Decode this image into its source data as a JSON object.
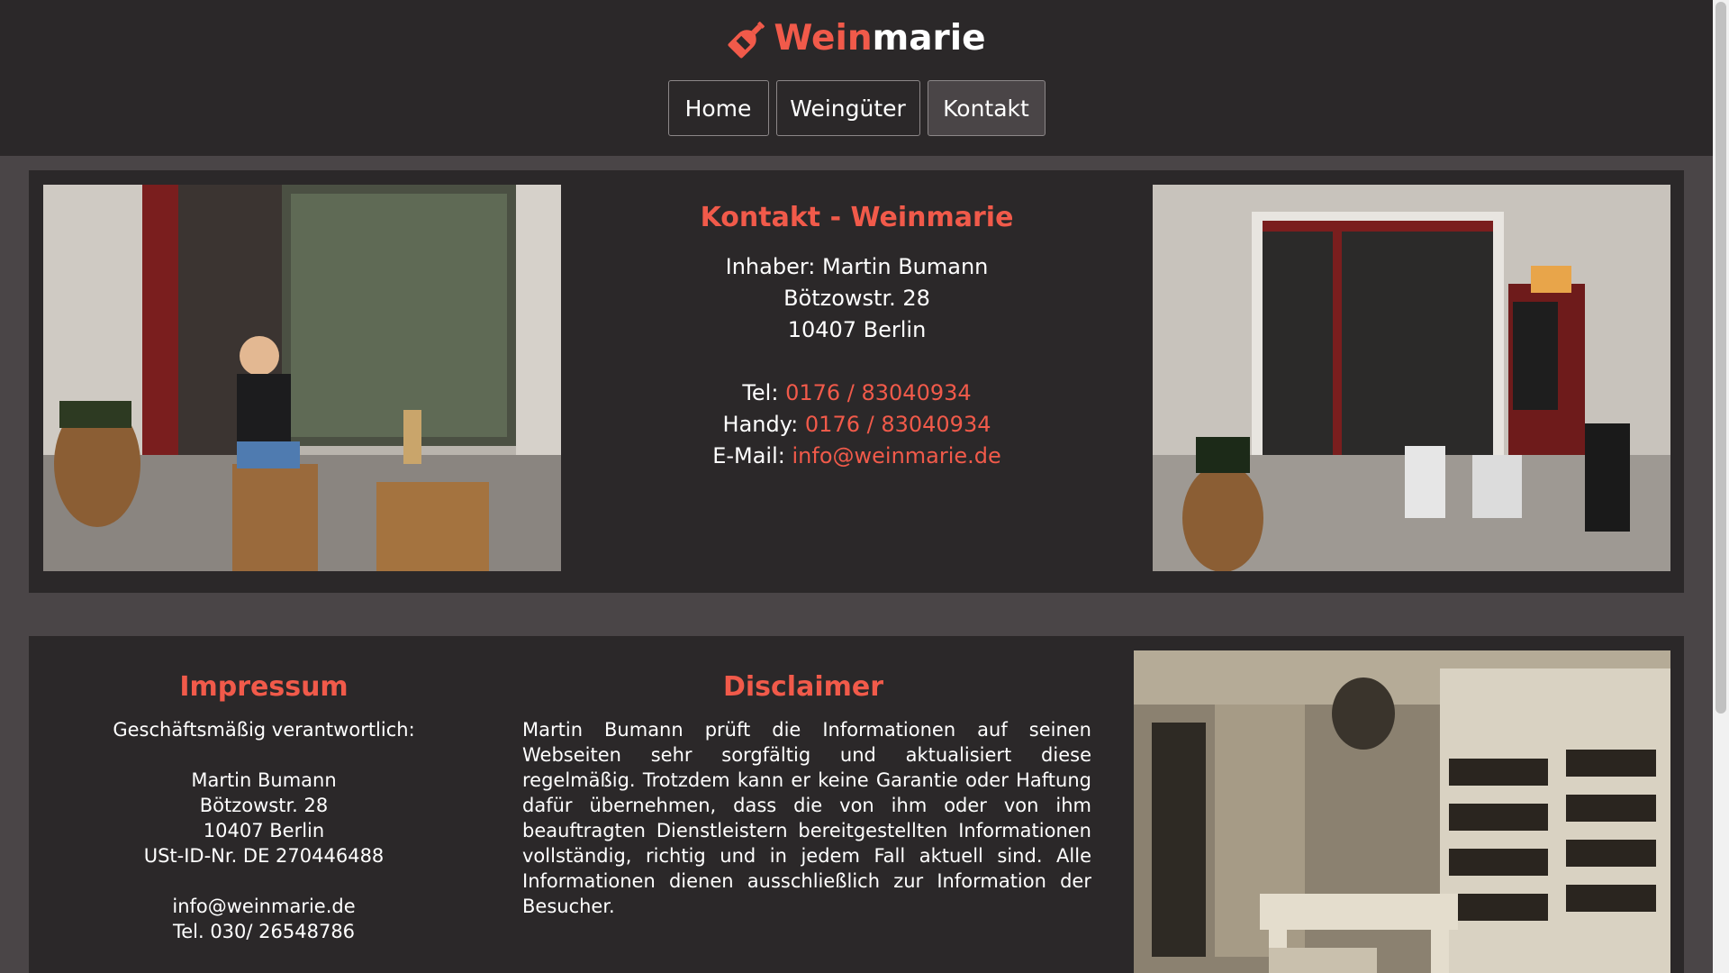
{
  "header": {
    "logo_part1": "Wein",
    "logo_part2": "marie",
    "logo_icon": "wine-bottle-icon",
    "accent_color": "#f15a4a",
    "nav": [
      {
        "label": "Home",
        "active": false
      },
      {
        "label": "Weingüter",
        "active": false
      },
      {
        "label": "Kontakt",
        "active": true
      }
    ]
  },
  "contact": {
    "title": "Kontakt - Weinmarie",
    "owner": "Inhaber: Martin Bumann",
    "street": "Bötzowstr. 28",
    "city": "10407 Berlin",
    "tel_label": "Tel:",
    "tel_value": "0176 / 83040934",
    "handy_label": "Handy:",
    "handy_value": "0176 / 83040934",
    "email_label": "E-Mail:",
    "email_value": "info@weinmarie.de"
  },
  "impressum": {
    "title": "Impressum",
    "responsible": "Geschäftsmäßig verantwortlich:",
    "name": "Martin Bumann",
    "street": "Bötzowstr. 28",
    "city": "10407 Berlin",
    "vat": "USt-ID-Nr. DE 270446488",
    "email": "info@weinmarie.de",
    "tel": "Tel. 030/ 26548786"
  },
  "disclaimer": {
    "title": "Disclaimer",
    "text": "Martin Bumann prüft die Informationen auf seinen Webseiten sehr sorgfältig und aktualisiert diese regelmäßig. Trotzdem kann er keine Garantie oder Haftung dafür übernehmen, dass die von ihm oder von ihm beauftragten Dienstleistern bereitgestellten Informationen vollständig, richtig und in jedem Fall aktuell sind. Alle Informationen dienen ausschließlich zur Information der Besucher."
  }
}
